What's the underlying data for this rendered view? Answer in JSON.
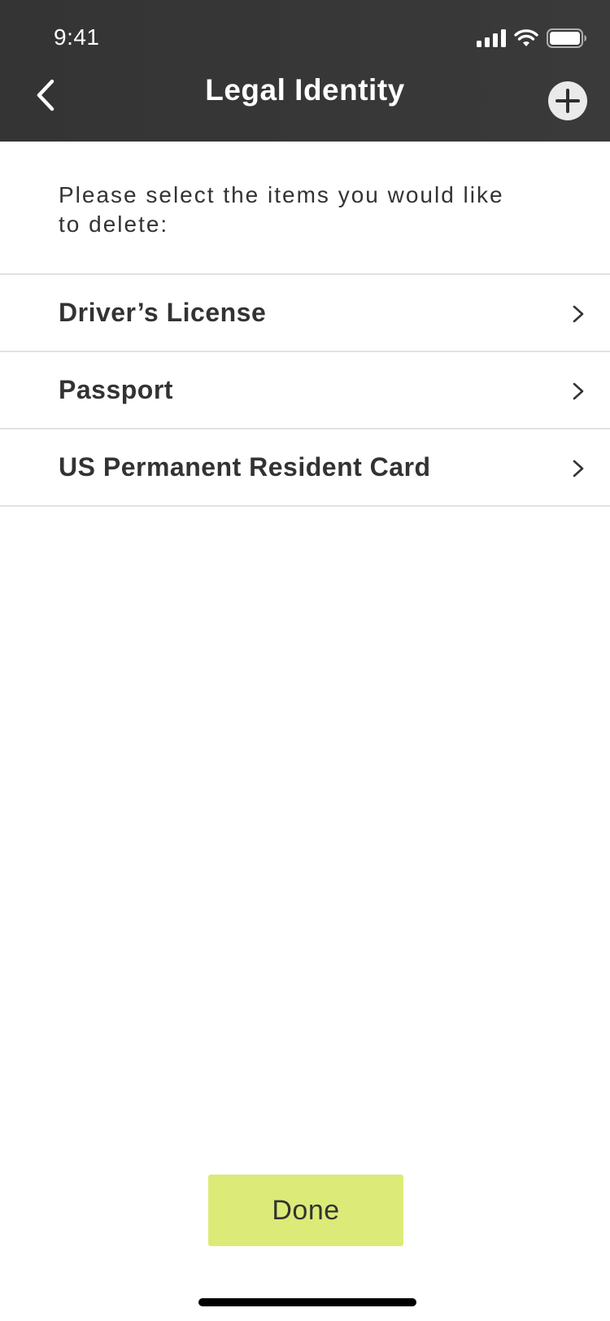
{
  "status_bar": {
    "time": "9:41"
  },
  "nav": {
    "title": "Legal Identity"
  },
  "instruction": "Please select the items you would like to delete:",
  "items": [
    {
      "label": "Driver’s License"
    },
    {
      "label": "Passport"
    },
    {
      "label": "US Permanent Resident Card"
    }
  ],
  "done_label": "Done",
  "colors": {
    "header_bg": "#363636",
    "accent": "#dceb77",
    "text": "#333333",
    "divider": "#e2e2e2"
  }
}
